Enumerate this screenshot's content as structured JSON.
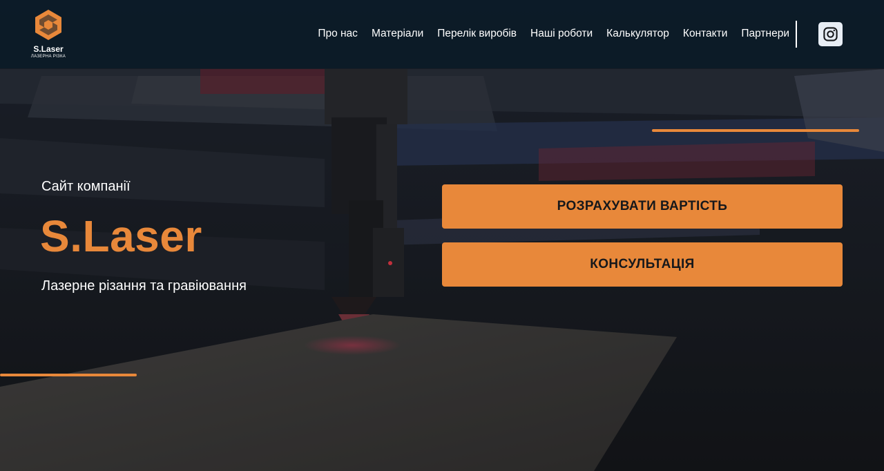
{
  "header": {
    "logo": {
      "name": "S.Laser",
      "subtitle": "ЛАЗЕРНА РІЗКА"
    },
    "nav": {
      "items": [
        {
          "label": "Про нас"
        },
        {
          "label": "Матеріали"
        },
        {
          "label": "Перелік виробів"
        },
        {
          "label": "Наші роботи"
        },
        {
          "label": "Калькулятор"
        },
        {
          "label": "Контакти"
        },
        {
          "label": "Партнери"
        }
      ]
    },
    "social": {
      "icon": "instagram-icon"
    }
  },
  "hero": {
    "kicker": "Сайт компанії",
    "title": "S.Laser",
    "subtitle": "Лазерне різання та гравіювання",
    "buttons": {
      "calculate": "РОЗРАХУВАТИ ВАРТІСТЬ",
      "consult": "КОНСУЛЬТАЦІЯ"
    }
  },
  "colors": {
    "accent": "#e8883a",
    "header_bg": "#0c1b28",
    "text_light": "#ffffff",
    "button_text": "#16181b"
  }
}
